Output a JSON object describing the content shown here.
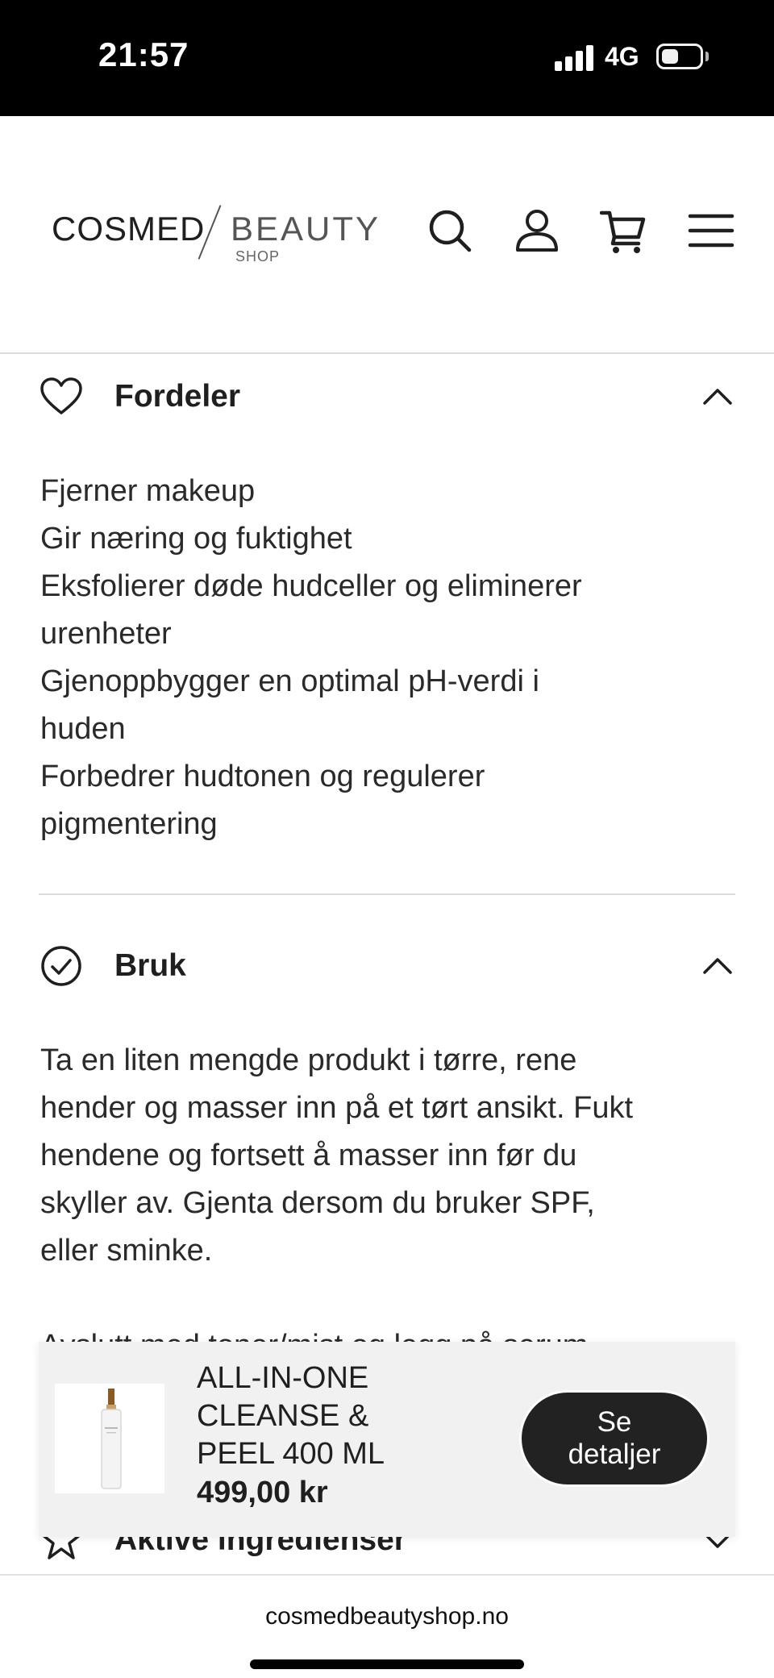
{
  "status_bar": {
    "time": "21:57",
    "network": "4G"
  },
  "header": {
    "logo": {
      "brand": "COSMED",
      "sub_brand": "BEAUTY",
      "shop": "SHOP"
    },
    "icons": [
      "search-icon",
      "account-icon",
      "cart-icon",
      "menu-icon"
    ]
  },
  "sections": {
    "fordeler": {
      "title": "Fordeler",
      "icon": "heart-icon",
      "lines": [
        "Fjerner makeup",
        "Gir næring og fuktighet",
        "Eksfolierer døde hudceller og eliminerer",
        "urenheter",
        "Gjenoppbygger en optimal pH-verdi i",
        "huden",
        "Forbedrer hudtonen og regulerer",
        "pigmentering"
      ]
    },
    "bruk": {
      "title": "Bruk",
      "icon": "check-circle-icon",
      "lines": [
        "Ta en liten mengde produkt i tørre, rene",
        "hender og masser inn på et tørt ansikt. Fukt",
        "hendene og fortsett å masser inn før du",
        "skyller av. Gjenta dersom du bruker SPF,",
        "eller sminke."
      ],
      "partial_line": "Avslutt med toner/mist og legg på serum"
    },
    "aktive": {
      "title": "Aktive ingredienser",
      "icon": "star-icon"
    }
  },
  "sticky_product": {
    "name_lines": [
      "ALL-IN-ONE",
      "CLEANSE &",
      "PEEL 400 ML"
    ],
    "price": "499,00 kr",
    "button_lines": [
      "Se",
      "detaljer"
    ]
  },
  "browser": {
    "url": "cosmedbeautyshop.no"
  }
}
